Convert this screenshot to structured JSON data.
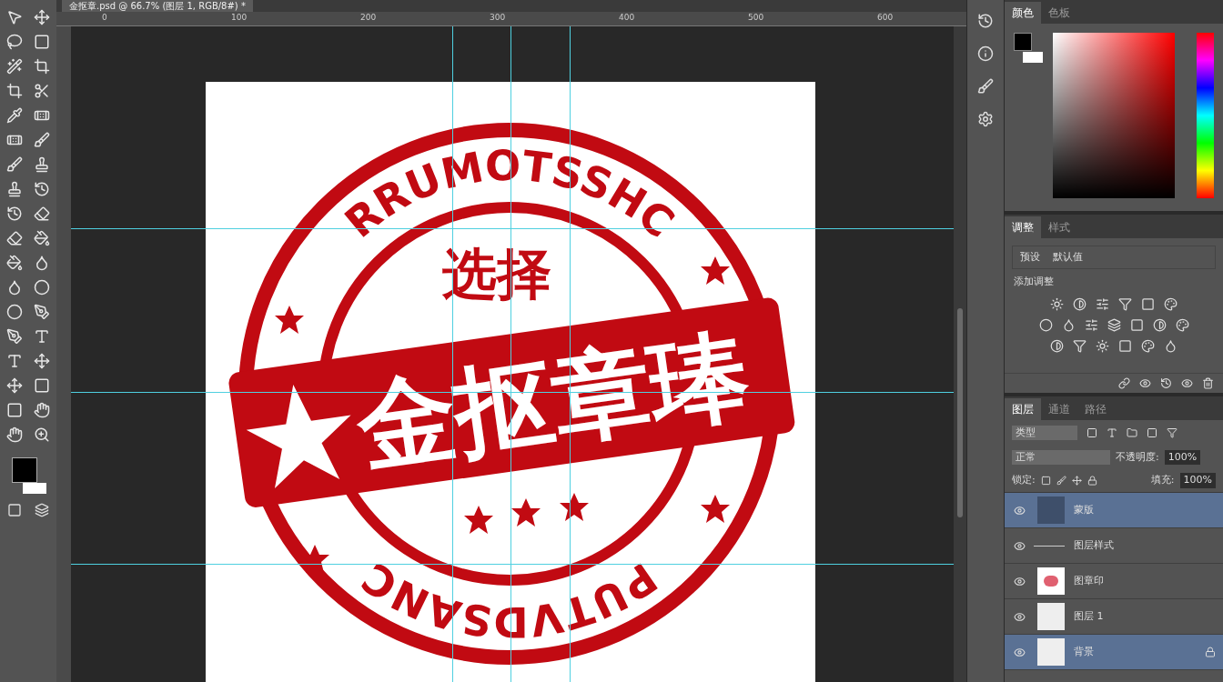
{
  "document_tab": {
    "title": "金抠章.psd @ 66.7% (图层 1, RGB/8#) *"
  },
  "ruler": {
    "labels": [
      "0",
      "100",
      "200",
      "300",
      "400",
      "500",
      "600"
    ]
  },
  "stamp": {
    "top_text": "RRUMOTSSHC",
    "middle_text": "选择",
    "band_text": "金抠章琫",
    "bottom_text": "PUTVDSANC"
  },
  "color_panel": {
    "tabs": [
      {
        "label": "颜色",
        "selected": true
      },
      {
        "label": "色板",
        "selected": false
      }
    ]
  },
  "adjustments_panel": {
    "tabs": [
      {
        "label": "调整",
        "selected": true
      },
      {
        "label": "样式",
        "selected": false
      }
    ],
    "preset_label": "预设",
    "preset_value": "默认值",
    "heading": "添加调整"
  },
  "layers_panel": {
    "tabs": [
      {
        "label": "图层",
        "selected": true
      },
      {
        "label": "通道",
        "selected": false
      },
      {
        "label": "路径",
        "selected": false
      }
    ],
    "filter": "类型",
    "blend_mode": "正常",
    "opacity_label": "不透明度:",
    "opacity": "100%",
    "lock_label": "锁定:",
    "fill_label": "填充:",
    "fill": "100%",
    "layers": [
      {
        "name": "蒙版",
        "kind": "mask",
        "visible": true,
        "selected": true,
        "locked": false
      },
      {
        "name": "图层样式",
        "kind": "effect",
        "visible": true,
        "selected": false,
        "locked": false
      },
      {
        "name": "图章印",
        "kind": "stamp",
        "visible": true,
        "selected": false,
        "locked": false
      },
      {
        "name": "图层 1",
        "kind": "empty",
        "visible": true,
        "selected": false,
        "locked": false
      },
      {
        "name": "背景",
        "kind": "empty",
        "visible": true,
        "selected": true,
        "locked": true
      }
    ]
  }
}
